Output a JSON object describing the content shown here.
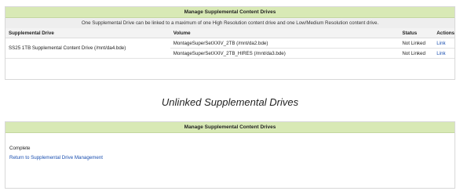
{
  "top_panel": {
    "title": "Manage Supplemental Content Drives",
    "notice": "One Supplemental Drive can be linked to a maximum of one High Resolution content drive and one Low/Medium Resolution content drive.",
    "columns": [
      "Supplemental Drive",
      "Volume",
      "Status",
      "Actions"
    ],
    "drive": "SS25 1TB Supplemental Content Drive (/mnt/da4.bde)",
    "rows": [
      {
        "volume": "MontageSuperSetXXIV_2TB (/mnt/da2.bde)",
        "status": "Not Linked",
        "action": "Link"
      },
      {
        "volume": "MontageSuperSetXXIV_2TB_HIRES (/mnt/da3.bde)",
        "status": "Not Linked",
        "action": "Link"
      }
    ]
  },
  "caption": "Unlinked Supplemental Drives",
  "bottom_panel": {
    "title": "Manage Supplemental Content Drives",
    "status": "Complete",
    "return_link": "Return to Supplemental Drive Management"
  }
}
